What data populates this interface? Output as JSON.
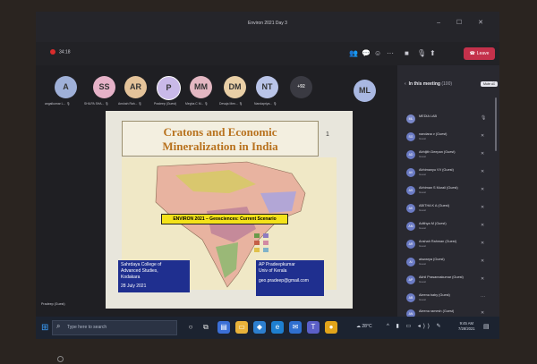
{
  "window": {
    "title": "Environ 2021 Day 3",
    "controls": "– ☐ ✕"
  },
  "toolbar": {
    "recording_time": "34:18",
    "leave_label": "Leave",
    "icons": [
      "people-icon",
      "chat-icon",
      "reactions-icon",
      "more-icon",
      "camera-icon",
      "mic-icon",
      "share-icon"
    ]
  },
  "gallery": {
    "avatars": [
      {
        "initials": "A",
        "color": "#9fb0d8",
        "name": "angaikumar L...  🎙"
      },
      {
        "initials": "SS",
        "color": "#e6b2c8",
        "name": "SHILPA SHA...  🎙"
      },
      {
        "initials": "AR",
        "color": "#e4c39a",
        "name": "Anshah Rah...  🎙"
      },
      {
        "initials": "P",
        "color": "#c9b9e8",
        "name": "Pradeep (Guest)"
      },
      {
        "initials": "MM",
        "color": "#e3b7c2",
        "name": "Megha C M...  🎙"
      },
      {
        "initials": "DM",
        "color": "#e9cfa6",
        "name": "Devaja Men...  🎙"
      },
      {
        "initials": "NT",
        "color": "#b9c4e8",
        "name": "Nandapriya...  🎙"
      },
      {
        "initials": "+92",
        "color": "#3a3a42",
        "name": ""
      },
      {
        "initials": "ML",
        "color": "#a9b8e2",
        "name": ""
      }
    ]
  },
  "slide": {
    "title_line1": "Cratons and Economic",
    "title_line2": "Mineralization in India",
    "page_number": "1",
    "banner": "ENVIRON 2021 – Geosciences: Current Scenario",
    "left_box": [
      "Sahrdaya College of",
      "Advanced Studies,",
      "Kodakara",
      "",
      "28 July 2021"
    ],
    "right_box": [
      "AP Pradeepkumar",
      "Univ of Kerala",
      "",
      "geo.pradeep@gmail.com"
    ]
  },
  "presenter_label": "Pradeep (Guest)",
  "panel": {
    "title": "In this meeting",
    "count": "(100)",
    "mute_all": "Mute all",
    "participants": [
      {
        "initials": "ML",
        "name": "MEDIA LAB",
        "sub": "",
        "color": "#7a88c9"
      },
      {
        "initials": "SG",
        "name": "nandana v (Guest)",
        "sub": "Guest",
        "color": "#6b7bc4"
      },
      {
        "initials": "AD",
        "name": "Abhijith Deepan (Guest)",
        "sub": "Guest",
        "color": "#6b7bc4"
      },
      {
        "initials": "AV",
        "name": "Abhimanyu VV (Guest)",
        "sub": "Guest",
        "color": "#6b7bc4"
      },
      {
        "initials": "AS",
        "name": "Abhiman S Murali (Guest)",
        "sub": "Guest",
        "color": "#6b7bc4"
      },
      {
        "initials": "AK",
        "name": "ABITHA K A (Guest)",
        "sub": "Guest",
        "color": "#6b7bc4"
      },
      {
        "initials": "AM",
        "name": "Adithya M (Guest)",
        "sub": "Guest",
        "color": "#6b7bc4"
      },
      {
        "initials": "AR",
        "name": "Anshah Rahman (Guest)",
        "sub": "Guest",
        "color": "#6b7bc4"
      },
      {
        "initials": "AI",
        "name": "aiswarya (Guest)",
        "sub": "Guest",
        "color": "#6b7bc4"
      },
      {
        "initials": "AP",
        "name": "Akhil Prasannakumar (Guest)",
        "sub": "Guest",
        "color": "#6b7bc4"
      },
      {
        "initials": "AB",
        "name": "Aleena baby (Guest)",
        "sub": "Guest",
        "color": "#6b7bc4"
      },
      {
        "initials": "AN",
        "name": "Aleena ramesh (Guest)",
        "sub": "Guest",
        "color": "#6b7bc4"
      }
    ]
  },
  "taskbar": {
    "search_placeholder": "Type here to search",
    "weather": "28°C",
    "time": "9:45 AM",
    "date": "7/28/2021"
  },
  "colors": {
    "leave": "#c4314b",
    "slide_title": "#b8721e",
    "banner": "#f4e21a",
    "info_box": "#1f2f8f"
  }
}
